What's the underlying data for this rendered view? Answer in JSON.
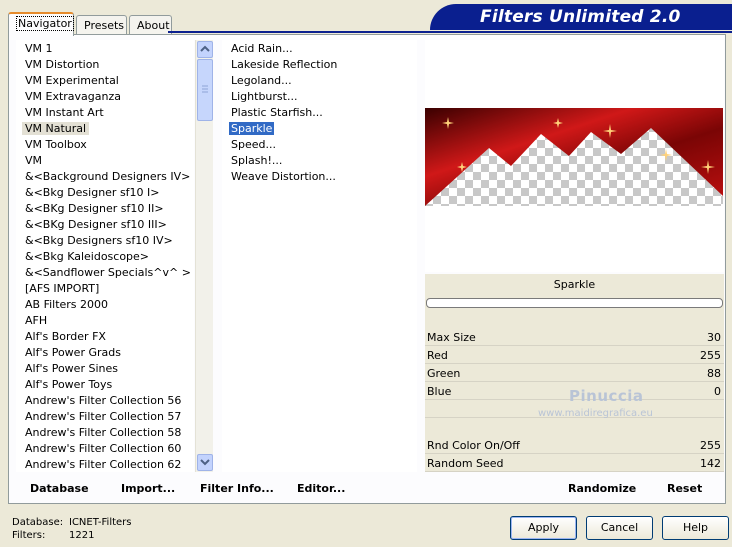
{
  "tabs": [
    {
      "label": "Navigator",
      "active": true
    },
    {
      "label": "Presets",
      "active": false
    },
    {
      "label": "About",
      "active": false
    }
  ],
  "banner_title": "Filters Unlimited 2.0",
  "categories": [
    "VM 1",
    "VM Distortion",
    "VM Experimental",
    "VM Extravaganza",
    "VM Instant Art",
    "VM Natural",
    "VM Toolbox",
    "VM",
    "&<Background Designers IV>",
    "&<Bkg Designer sf10 I>",
    "&<BKg Designer sf10 II>",
    "&<BKg Designer sf10 III>",
    "&<Bkg Designers sf10 IV>",
    "&<Bkg Kaleidoscope>",
    "&<Sandflower Specials^v^ >",
    "[AFS IMPORT]",
    "AB Filters 2000",
    "AFH",
    "Alf's Border FX",
    "Alf's Power Grads",
    "Alf's Power Sines",
    "Alf's Power Toys",
    "Andrew's Filter Collection 56",
    "Andrew's Filter Collection 57",
    "Andrew's Filter Collection 58",
    "Andrew's Filter Collection 60",
    "Andrew's Filter Collection 62"
  ],
  "selected_category": "VM Natural",
  "filters": [
    "Acid Rain...",
    "Lakeside Reflection",
    "Legoland...",
    "Lightburst...",
    "Plastic Starfish...",
    "Sparkle",
    "Speed...",
    "Splash!...",
    "Weave Distortion..."
  ],
  "selected_filter": "Sparkle",
  "preview_filter_name": "Sparkle",
  "params": [
    {
      "label": "Max Size",
      "value": "30"
    },
    {
      "label": "Red",
      "value": "255"
    },
    {
      "label": "Green",
      "value": "88"
    },
    {
      "label": "Blue",
      "value": "0"
    },
    {
      "label": "",
      "value": ""
    },
    {
      "label": "Rnd Color On/Off",
      "value": "255"
    },
    {
      "label": "Random Seed",
      "value": "142"
    }
  ],
  "bottom_buttons": {
    "database": "Database",
    "import": "Import...",
    "filter_info": "Filter Info...",
    "editor": "Editor..."
  },
  "randomize_label": "Randomize",
  "reset_label": "Reset",
  "status": {
    "database_label": "Database:",
    "database_value": "ICNET-Filters",
    "filters_label": "Filters:",
    "filters_value": "1221"
  },
  "dialog_buttons": {
    "apply": "Apply",
    "cancel": "Cancel",
    "help": "Help"
  },
  "watermark": {
    "name": "Pinuccia",
    "site": "www.maidiregrafica.eu"
  },
  "colors": {
    "banner": "#0a1f8f",
    "selection": "#316ac5",
    "tab_accent": "#e68b2c"
  }
}
